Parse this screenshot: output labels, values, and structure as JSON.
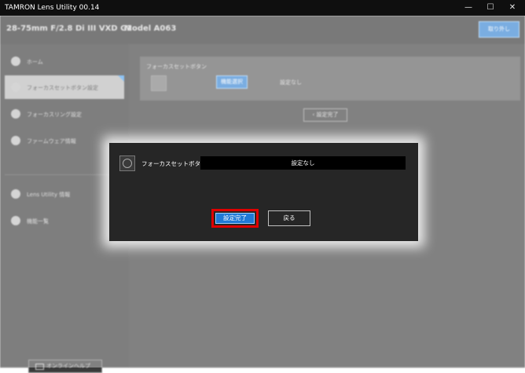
{
  "window": {
    "title": "TAMRON Lens Utility 00.14",
    "minimize": "—",
    "maximize": "☐",
    "close": "✕"
  },
  "header": {
    "lens_name": "28-75mm F/2.8 Di III VXD G2",
    "model": "Model A063",
    "detach_label": "取り外し"
  },
  "sidebar": {
    "items": [
      {
        "label": "ホーム",
        "icon": "home-icon"
      },
      {
        "label": "フォーカスセットボタン設定",
        "icon": "focus-button-icon",
        "active": true
      },
      {
        "label": "フォーカスリング設定",
        "icon": "focus-ring-icon"
      },
      {
        "label": "ファームウェア情報",
        "icon": "firmware-icon"
      },
      {
        "label": "Lens Utility 情報",
        "icon": "info-icon"
      },
      {
        "label": "機能一覧",
        "icon": "list-icon"
      }
    ],
    "help_label": "オンラインヘルプ"
  },
  "main": {
    "panel_label": "フォーカスセットボタン",
    "function_select_label": "機能選択",
    "status": "設定なし",
    "done_label": "設定完了"
  },
  "modal": {
    "label": "フォーカスセットボタン",
    "value": "設定なし",
    "confirm_label": "設定完了",
    "back_label": "戻る",
    "highlight_color": "#e00000",
    "accent_color": "#1f79d6"
  }
}
